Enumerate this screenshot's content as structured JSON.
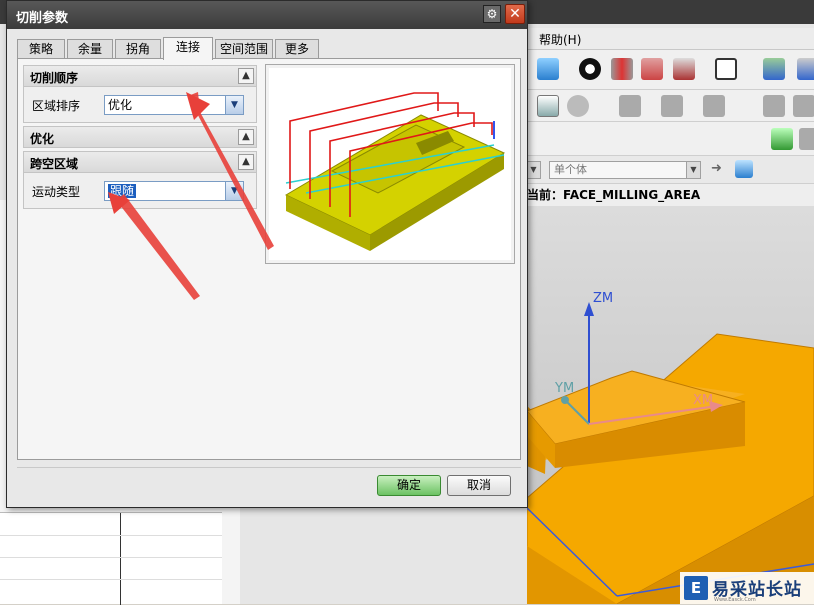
{
  "dialog": {
    "title": "切削参数",
    "tabs": [
      {
        "label": "策略"
      },
      {
        "label": "余量"
      },
      {
        "label": "拐角"
      },
      {
        "label": "连接"
      },
      {
        "label": "空间范围"
      },
      {
        "label": "更多"
      }
    ],
    "active_tab": "连接",
    "groups": {
      "cut_order": {
        "title": "切削顺序",
        "region_sort_label": "区域排序",
        "region_sort_value": "优化"
      },
      "optimize": {
        "title": "优化"
      },
      "cross_region": {
        "title": "跨空区域",
        "motion_type_label": "运动类型",
        "motion_type_value": "跟随"
      }
    },
    "ok_label": "确定",
    "cancel_label": "取消"
  },
  "background_app": {
    "menu_help": "帮助(H)",
    "selection_combo": "单个体",
    "status_text": "当前：FACE_MILLING_AREA",
    "axis_labels": {
      "zm": "ZM",
      "ym": "YM",
      "xm": "XM"
    },
    "watermark": {
      "logo": "E",
      "text": "易采站长站",
      "sub": "Www.Easck.Com"
    }
  },
  "colors": {
    "dialog_title_bg": "#3c3c3c",
    "part_orange": "#f5a800",
    "arrow_red": "#e8403a",
    "selection_blue": "#1d5fbf",
    "ok_green": "#6cc263"
  }
}
